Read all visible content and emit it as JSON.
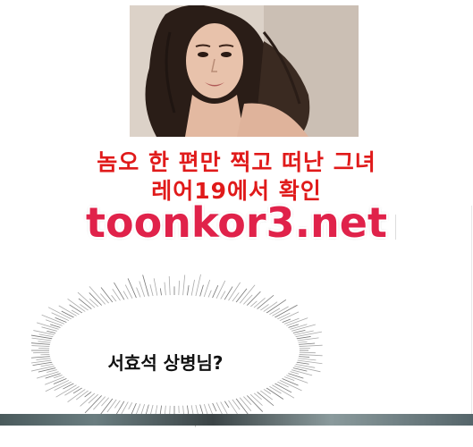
{
  "ad": {
    "line1": "놈오 한 편만 찍고 떠난 그녀",
    "line2": "레어19에서 확인",
    "url": "toonkor3.net"
  },
  "speech": {
    "text": "서효석 상병님?"
  },
  "colors": {
    "ad_text": "#e01a1a",
    "url_text": "#e0224a",
    "background": "#ffffff"
  }
}
